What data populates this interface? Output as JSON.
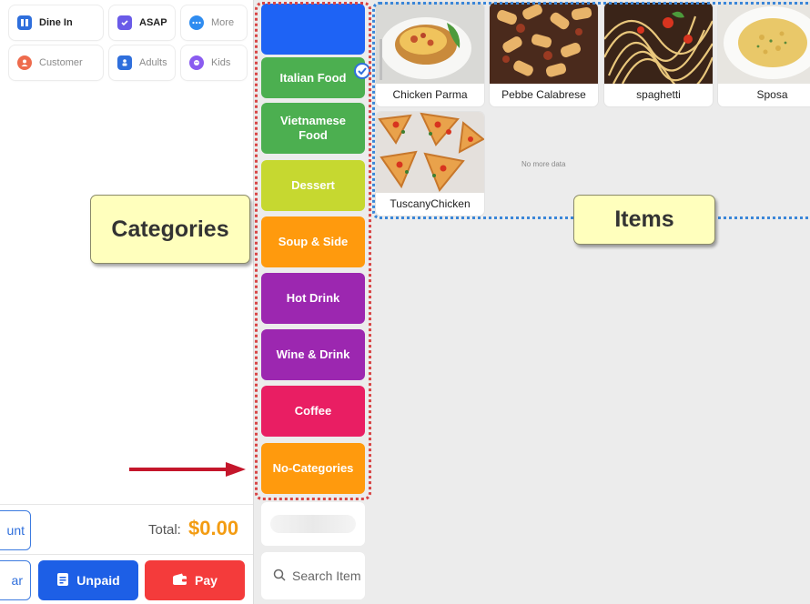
{
  "order_options": {
    "dine_in": "Dine In",
    "asap": "ASAP",
    "more": "More",
    "customer": "Customer",
    "adults": "Adults",
    "kids": "Kids"
  },
  "totals": {
    "discount_label": "unt",
    "total_label": "Total:",
    "total_value": "$0.00"
  },
  "actions": {
    "clear_label": "ar",
    "unpaid_label": "Unpaid",
    "pay_label": "Pay"
  },
  "categories": [
    {
      "label": "",
      "color": "#1e63f5"
    },
    {
      "label": "Italian Food",
      "color": "#4caf50",
      "selected": true
    },
    {
      "label": "Vietnamese Food",
      "color": "#4caf50"
    },
    {
      "label": "Dessert",
      "color": "#c6d830"
    },
    {
      "label": "Soup & Side",
      "color": "#ff9a0d"
    },
    {
      "label": "Hot Drink",
      "color": "#9c27b0"
    },
    {
      "label": "Wine & Drink",
      "color": "#9c27b0"
    },
    {
      "label": "Coffee",
      "color": "#e91e63"
    },
    {
      "label": "No-Categories",
      "color": "#ff9a0d"
    }
  ],
  "search": {
    "placeholder": "Search Item"
  },
  "items": [
    {
      "name": "Chicken Parma"
    },
    {
      "name": "Pebbe Calabrese"
    },
    {
      "name": "spaghetti"
    },
    {
      "name": "Sposa"
    },
    {
      "name": "TuscanyChicken"
    }
  ],
  "no_more_data": "No more data",
  "callouts": {
    "categories": "Categories",
    "items": "Items"
  }
}
